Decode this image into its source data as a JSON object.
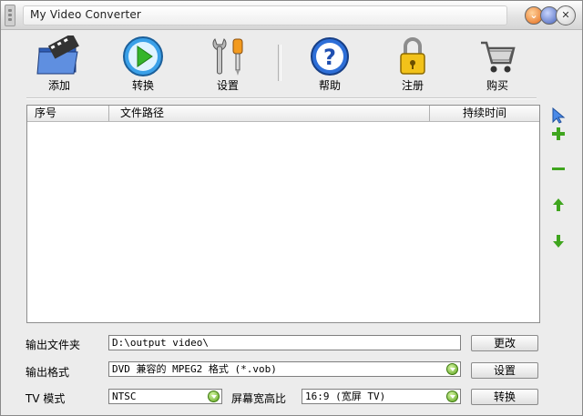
{
  "window": {
    "title": "My Video Converter"
  },
  "toolbar": {
    "add": "添加",
    "convert": "转换",
    "settings": "设置",
    "help": "帮助",
    "register": "注册",
    "buy": "购买"
  },
  "list": {
    "columns": [
      "序号",
      "文件路径",
      "持续时间"
    ],
    "rows": []
  },
  "side_buttons": [
    "cursor-icon",
    "add-icon",
    "remove-icon",
    "move-up-icon",
    "move-down-icon"
  ],
  "form": {
    "output_folder_label": "输出文件夹",
    "output_folder_value": "D:\\output video\\",
    "change_button": "更改",
    "output_format_label": "输出格式",
    "output_format_value": "DVD 兼容的 MPEG2 格式 (*.vob)",
    "settings_button": "设置",
    "tv_mode_label": "TV 模式",
    "tv_mode_value": "NTSC",
    "aspect_label": "屏幕宽高比",
    "aspect_value": "16:9 (宽屏 TV)",
    "convert_button": "转换"
  },
  "colors": {
    "window_bg": "#ececec",
    "accent_green": "#5aa21c",
    "accent_blue": "#3a66c8"
  }
}
